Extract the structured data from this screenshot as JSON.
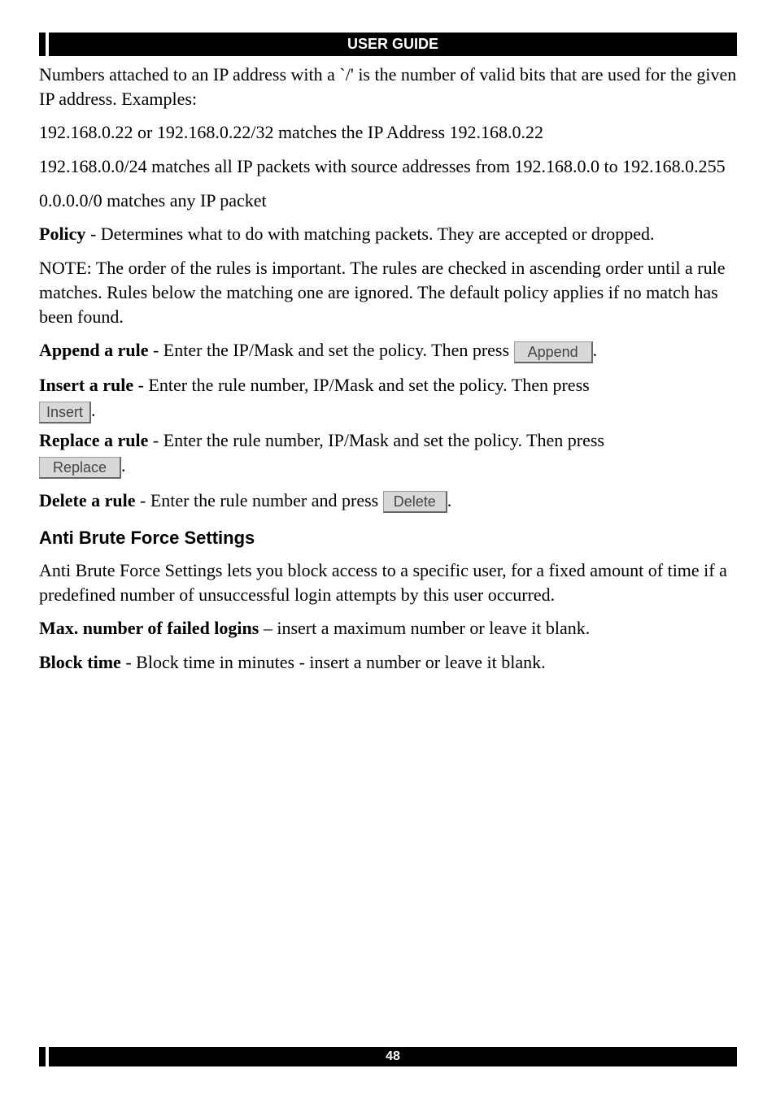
{
  "header": {
    "title": "USER GUIDE"
  },
  "content": {
    "p1": "Numbers attached to an IP address with a `/' is the number of valid bits that are used for the given IP address. Examples:",
    "p2": "192.168.0.22 or 192.168.0.22/32 matches the IP Address 192.168.0.22",
    "p3": "192.168.0.0/24 matches all IP packets with source addresses from 192.168.0.0 to 192.168.0.255",
    "p4": "0.0.0.0/0 matches any IP packet",
    "policy_label": "Policy",
    "policy_text": " - Determines what to do with matching packets. They are accepted or dropped.",
    "note": "NOTE: The order of the rules is important. The rules are checked in ascending order until a rule matches. Rules below the matching one are ignored. The default policy applies if no match has been found.",
    "append_label": "Append a rule",
    "append_text": " - Enter the IP/Mask and set the policy. Then press ",
    "append_btn": "Append",
    "period": ".",
    "insert_label": "Insert a rule",
    "insert_text": " - Enter the rule number, IP/Mask and set the policy. Then press ",
    "insert_btn": "Insert",
    "replace_label": "Replace a rule",
    "replace_text": " - Enter the rule number, IP/Mask and set the policy. Then press ",
    "replace_btn": "Replace",
    "delete_label": "Delete a rule",
    "delete_text": " - Enter the rule number and press ",
    "delete_btn": "Delete",
    "abf_heading": "Anti Brute Force Settings",
    "abf_intro": "Anti Brute Force Settings lets you block access to a specific user, for a fixed amount of time if a predefined number of unsuccessful login attempts by this user occurred.",
    "max_label": "Max. number of failed logins",
    "max_text": " – insert a maximum number or leave it blank.",
    "block_label": "Block time",
    "block_text": " - Block time in minutes - insert a number or leave it blank."
  },
  "footer": {
    "page": "48"
  }
}
